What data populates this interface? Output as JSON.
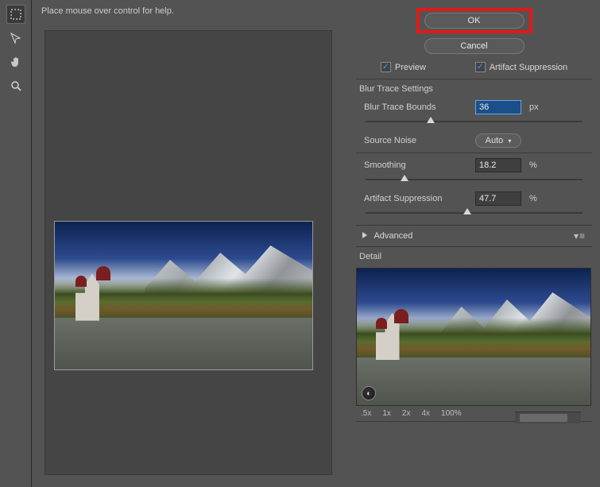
{
  "help_text": "Place mouse over control for help.",
  "buttons": {
    "ok": "OK",
    "cancel": "Cancel"
  },
  "checks": {
    "preview": "Preview",
    "artifact": "Artifact Suppression"
  },
  "trace_section": {
    "title": "Blur Trace Settings",
    "bounds_label": "Blur Trace Bounds",
    "bounds_value": "36",
    "bounds_unit": "px",
    "noise_label": "Source Noise",
    "noise_value": "Auto",
    "smoothing_label": "Smoothing",
    "smoothing_value": "18.2",
    "smoothing_unit": "%",
    "artifact_label": "Artifact Suppression",
    "artifact_value": "47.7",
    "artifact_unit": "%"
  },
  "advanced_label": "Advanced",
  "detail_label": "Detail",
  "zoom": {
    "z05": ".5x",
    "z1": "1x",
    "z2": "2x",
    "z4": "4x",
    "pct": "100%"
  },
  "slider_positions": {
    "bounds_pct": 30,
    "smoothing_pct": 18,
    "artifact_pct": 47
  }
}
